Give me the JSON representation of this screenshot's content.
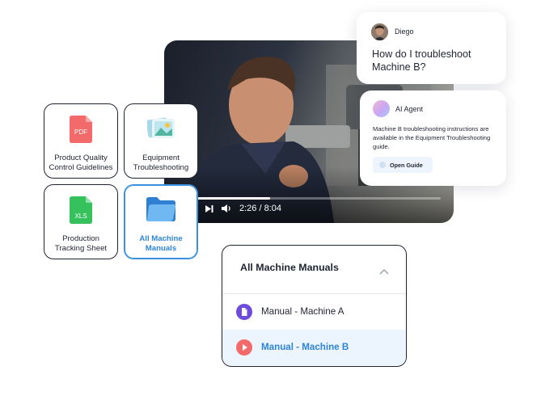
{
  "video": {
    "time_display": "2:26 / 8:04",
    "progress": 0.3
  },
  "tiles": [
    {
      "label": "Product Quality Control Guidelines",
      "icon": "pdf-file-icon",
      "icon_text": "PDF",
      "icon_color": "#f36a6a"
    },
    {
      "label": "Equipment Troubleshooting",
      "icon": "image-file-icon",
      "icon_color": "#6cc7b8"
    },
    {
      "label": "Production Tracking Sheet",
      "icon": "xls-file-icon",
      "icon_text": "XLS",
      "icon_color": "#35c25c"
    },
    {
      "label": "All Machine Manuals",
      "icon": "folder-icon",
      "icon_color": "#4a9ee8",
      "selected": true
    }
  ],
  "chat": {
    "user_name": "Diego",
    "question": "How do I troubleshoot Machine B?",
    "agent_name": "AI Agent",
    "answer": "Machine B troubleshooting instructions are available in the Equipment Troubleshooting guide.",
    "guide_button": "Open Guide"
  },
  "dropdown": {
    "title": "All Machine Manuals",
    "items": [
      {
        "label": "Manual - Machine A",
        "icon": "document-icon",
        "color": "#6d4bdc"
      },
      {
        "label": "Manual - Machine B",
        "icon": "play-icon",
        "color": "#f36a6a",
        "selected": true
      }
    ]
  },
  "colors": {
    "accent": "#2d84d8",
    "border": "#1f2433"
  }
}
